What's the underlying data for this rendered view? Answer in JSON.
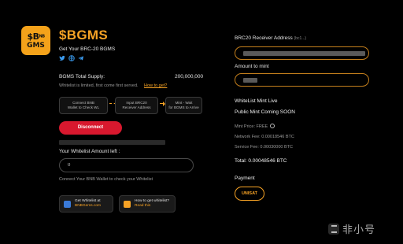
{
  "logo": {
    "line1_main": "$B",
    "line1_small": "NB",
    "line2": "GMS"
  },
  "header": {
    "title": "$BGMS",
    "subtitle": "Get Your BRC-20 BGMS",
    "socials": [
      "twitter-icon",
      "globe-icon",
      "telegram-icon"
    ]
  },
  "supply": {
    "label": "BGMS Total Supply:",
    "value": "200,000,000"
  },
  "whitelist_note": {
    "text": "Whitelist is limited, first come first served.",
    "link": "How to get?"
  },
  "steps": [
    {
      "line1": "Connect BNB",
      "line2": "Wallet to Check WL"
    },
    {
      "line1": "Input BRC20",
      "line2": "Receiver Address"
    },
    {
      "line1": "Mint - Wait",
      "line2": "for BGMS to Arrive"
    }
  ],
  "disconnect_label": "Disconnect",
  "amount_left_label": "Your Whitelist Amount left :",
  "amount_input_value": "0",
  "connect_note": "Connect Your BNB Wallet to check your Whitelist",
  "cards": [
    {
      "title": "Get Whitelist at",
      "sub": "BNBGems.com"
    },
    {
      "title": "How to get whitelist?",
      "sub": "Read this"
    }
  ],
  "right": {
    "receiver_label": "BRC20 Receiver Address",
    "receiver_hint": "(bc1...)",
    "amount_label": "Amount to mint",
    "wl_status": "WhiteList Mint Live",
    "public_status": "Public Mint Coming SOON",
    "mint_price": "Mint Price: FREE",
    "network_fee": "Network Fee: 0.00018546 BTC",
    "service_fee": "Service Fee: 0.00030000 BTC",
    "total": "Total: 0.00048546 BTC",
    "payment_label": "Payment",
    "unisat_label": "UNISAT"
  },
  "watermark": {
    "text": "非小号"
  },
  "colors": {
    "accent": "#f7a325",
    "danger": "#d8182e",
    "background": "#000000"
  }
}
